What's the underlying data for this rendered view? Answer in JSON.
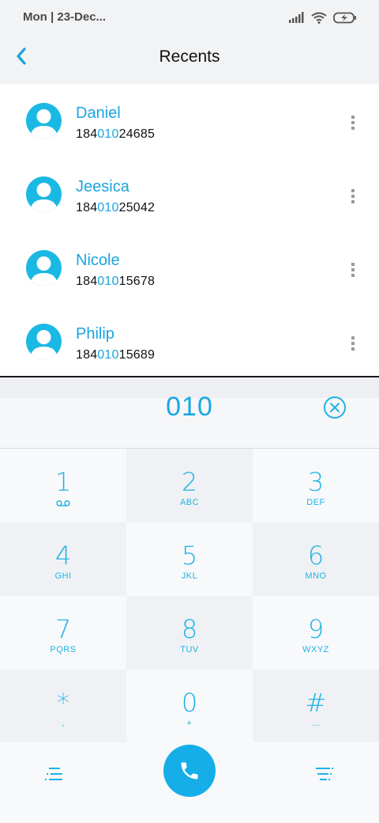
{
  "status": {
    "time": "Mon | 23-Dec..."
  },
  "header": {
    "title": "Recents"
  },
  "contacts": [
    {
      "name": "Daniel",
      "number_pre": "184",
      "number_hl": "010",
      "number_post": "24685"
    },
    {
      "name": "Jeesica",
      "number_pre": "184",
      "number_hl": "010",
      "number_post": "25042"
    },
    {
      "name": "Nicole",
      "number_pre": "184",
      "number_hl": "010",
      "number_post": "15678"
    },
    {
      "name": "Philip",
      "number_pre": "184",
      "number_hl": "010",
      "number_post": "15689"
    }
  ],
  "dialer": {
    "entered": "010"
  },
  "keys": [
    {
      "digit": "1",
      "letters": "",
      "icon": "voicemail-icon"
    },
    {
      "digit": "2",
      "letters": "ABC"
    },
    {
      "digit": "3",
      "letters": "DEF"
    },
    {
      "digit": "4",
      "letters": "GHI"
    },
    {
      "digit": "5",
      "letters": "JKL"
    },
    {
      "digit": "6",
      "letters": "MNO"
    },
    {
      "digit": "7",
      "letters": "PQRS"
    },
    {
      "digit": "8",
      "letters": "TUV"
    },
    {
      "digit": "9",
      "letters": "WXYZ"
    },
    {
      "digit": "*",
      "letters": ","
    },
    {
      "digit": "0",
      "letters": "+"
    },
    {
      "digit": "#",
      "letters": "..."
    }
  ],
  "colors": {
    "accent": "#19a7e3",
    "call": "#16aee8",
    "avatar": "#1ab9e3"
  }
}
